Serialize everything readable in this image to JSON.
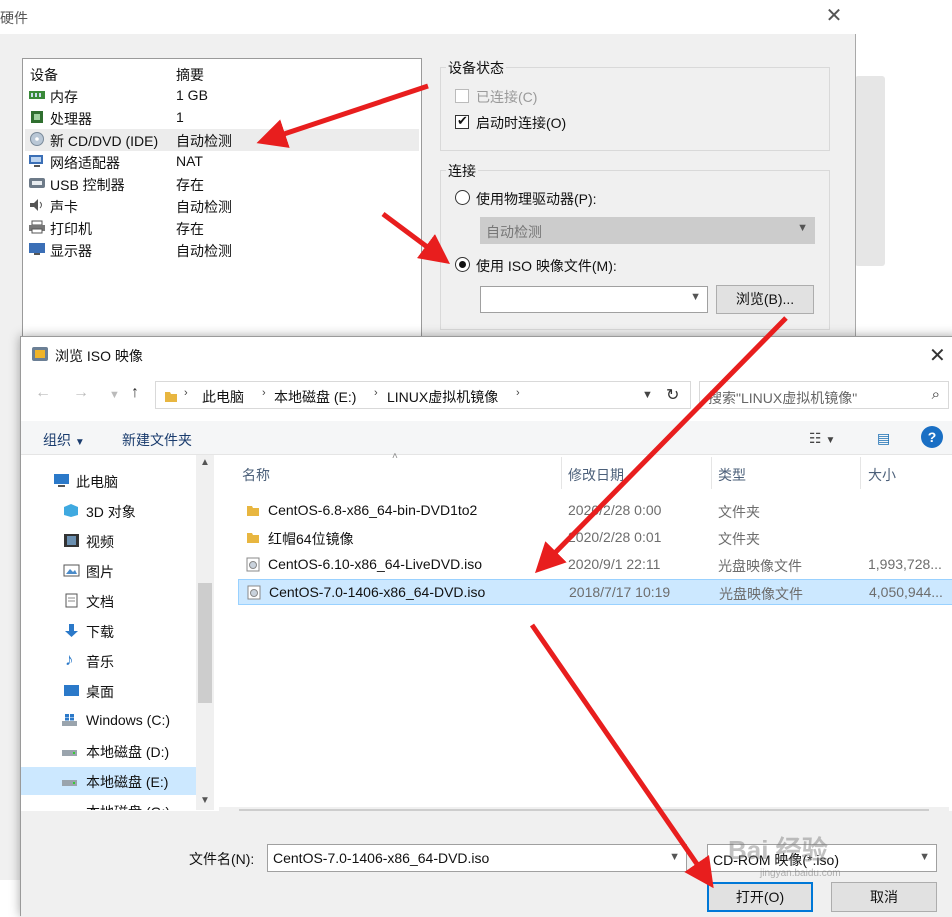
{
  "hardware_dialog": {
    "title": "硬件",
    "device_list": {
      "headers": {
        "device": "设备",
        "summary": "摘要"
      },
      "items": [
        {
          "name": "内存",
          "summary": "1 GB",
          "icon": "memory-icon"
        },
        {
          "name": "处理器",
          "summary": "1",
          "icon": "processor-icon"
        },
        {
          "name": "新 CD/DVD (IDE)",
          "summary": "自动检测",
          "icon": "cd-dvd-icon",
          "selected": true
        },
        {
          "name": "网络适配器",
          "summary": "NAT",
          "icon": "network-adapter-icon"
        },
        {
          "name": "USB 控制器",
          "summary": "存在",
          "icon": "usb-icon"
        },
        {
          "name": "声卡",
          "summary": "自动检测",
          "icon": "sound-card-icon"
        },
        {
          "name": "打印机",
          "summary": "存在",
          "icon": "printer-icon"
        },
        {
          "name": "显示器",
          "summary": "自动检测",
          "icon": "display-icon"
        }
      ]
    },
    "device_status": {
      "title": "设备状态",
      "connected": {
        "label": "已连接(C)",
        "checked": false,
        "enabled": false
      },
      "connect_at_power_on": {
        "label": "启动时连接(O)",
        "checked": true
      }
    },
    "connection": {
      "title": "连接",
      "physical_drive": {
        "label": "使用物理驱动器(P):",
        "selected": false,
        "value": "自动检测"
      },
      "iso_image": {
        "label": "使用 ISO 映像文件(M):",
        "selected": true,
        "value": ""
      },
      "browse_label": "浏览(B)..."
    }
  },
  "browse_dialog": {
    "title": "浏览 ISO 映像",
    "breadcrumb": [
      "此电脑",
      "本地磁盘 (E:)",
      "LINUX虚拟机镜像"
    ],
    "search_placeholder": "搜索\"LINUX虚拟机镜像\"",
    "commands": {
      "organize": "组织",
      "new_folder": "新建文件夹"
    },
    "nav_tree": [
      {
        "label": "此电脑",
        "icon": "computer-icon"
      },
      {
        "label": "3D 对象",
        "icon": "3d-objects-icon"
      },
      {
        "label": "视频",
        "icon": "video-icon"
      },
      {
        "label": "图片",
        "icon": "pictures-icon"
      },
      {
        "label": "文档",
        "icon": "documents-icon"
      },
      {
        "label": "下载",
        "icon": "download-icon"
      },
      {
        "label": "音乐",
        "icon": "music-icon"
      },
      {
        "label": "桌面",
        "icon": "desktop-icon"
      },
      {
        "label": "Windows (C:)",
        "icon": "windows-drive-icon"
      },
      {
        "label": "本地磁盘 (D:)",
        "icon": "drive-icon"
      },
      {
        "label": "本地磁盘 (E:)",
        "icon": "drive-icon",
        "selected": true
      },
      {
        "label": "本地磁盘 (G:)",
        "icon": "drive-icon"
      }
    ],
    "columns": {
      "name": "名称",
      "modified": "修改日期",
      "type": "类型",
      "size": "大小"
    },
    "files": [
      {
        "name": "CentOS-6.8-x86_64-bin-DVD1to2",
        "modified": "2020/2/28 0:00",
        "type": "文件夹",
        "size": "",
        "icon": "folder-icon"
      },
      {
        "name": "红帽64位镜像",
        "modified": "2020/2/28 0:01",
        "type": "文件夹",
        "size": "",
        "icon": "folder-icon"
      },
      {
        "name": "CentOS-6.10-x86_64-LiveDVD.iso",
        "modified": "2020/9/1 22:11",
        "type": "光盘映像文件",
        "size": "1,993,728...",
        "icon": "disc-image-icon"
      },
      {
        "name": "CentOS-7.0-1406-x86_64-DVD.iso",
        "modified": "2018/7/17 10:19",
        "type": "光盘映像文件",
        "size": "4,050,944...",
        "icon": "disc-image-icon",
        "selected": true
      }
    ],
    "filename_label": "文件名(N):",
    "filename_value": "CentOS-7.0-1406-x86_64-DVD.iso",
    "filetype_value": "CD-ROM 映像(*.iso)",
    "open_label": "打开(O)",
    "cancel_label": "取消"
  },
  "watermark": {
    "text": "Bai 经验",
    "sub": "jingyan.baidu.com"
  },
  "colors": {
    "arrow": "#e81e1e",
    "selection": "#cce8ff",
    "accent": "#0078d7"
  }
}
